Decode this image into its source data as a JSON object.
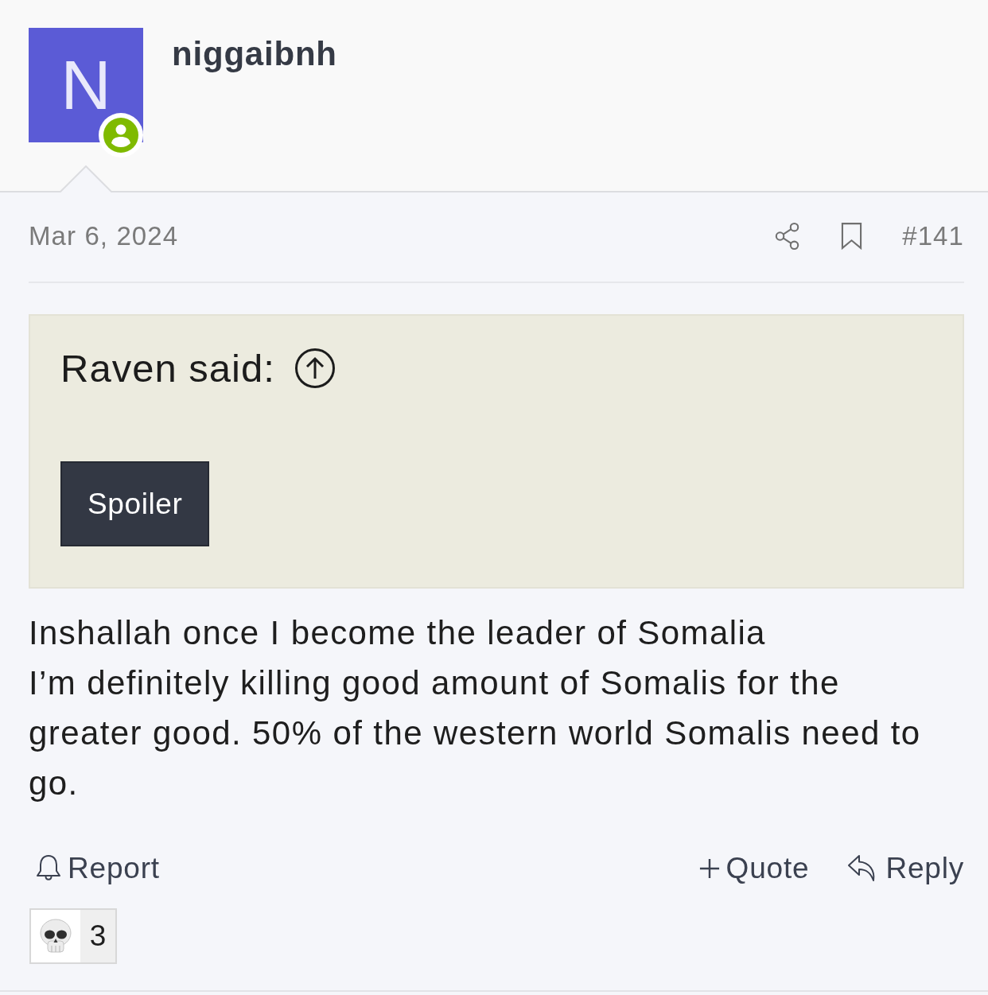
{
  "author": {
    "avatar_letter": "N",
    "name": "niggaibnh",
    "online": true
  },
  "post": {
    "date": "Mar 6, 2024",
    "number": "#141"
  },
  "quote": {
    "attribution": "Raven said:",
    "spoiler_button": "Spoiler"
  },
  "body": "Inshallah once I become the leader of Somalia\nI’m definitely killing good amount of Somalis for the greater good. 50% of the western world Somalis need to go.",
  "actions": {
    "left": [
      {
        "kind": "report",
        "label": "Report"
      }
    ],
    "right": [
      {
        "kind": "quote",
        "label": "Quote"
      },
      {
        "kind": "reply",
        "label": "Reply"
      }
    ]
  },
  "reactions": [
    {
      "count": "3"
    }
  ]
}
